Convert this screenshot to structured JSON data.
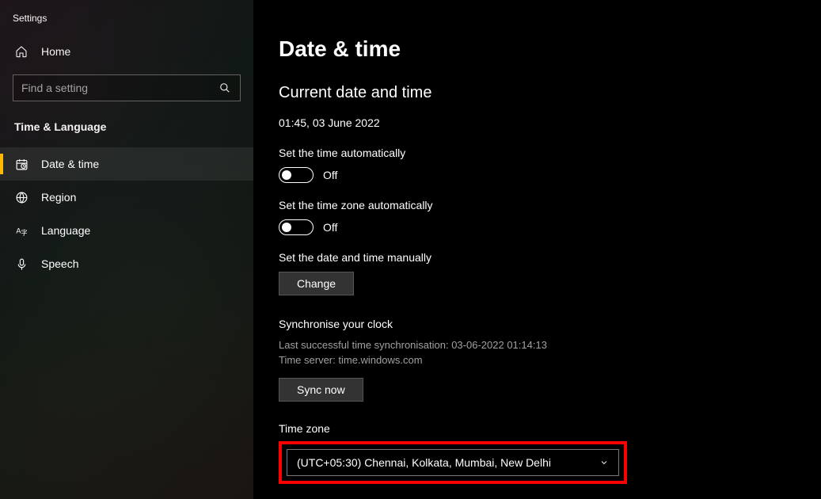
{
  "app": {
    "title": "Settings"
  },
  "sidebar": {
    "home_label": "Home",
    "search_placeholder": "Find a setting",
    "category": "Time & Language",
    "items": [
      {
        "label": "Date & time",
        "icon": "clock-icon",
        "active": true
      },
      {
        "label": "Region",
        "icon": "globe-icon",
        "active": false
      },
      {
        "label": "Language",
        "icon": "language-icon",
        "active": false
      },
      {
        "label": "Speech",
        "icon": "microphone-icon",
        "active": false
      }
    ]
  },
  "page": {
    "title": "Date & time",
    "current_section": "Current date and time",
    "current_value": "01:45, 03 June 2022",
    "auto_time_label": "Set the time automatically",
    "auto_time_state": "Off",
    "auto_tz_label": "Set the time zone automatically",
    "auto_tz_state": "Off",
    "manual_label": "Set the date and time manually",
    "change_button": "Change",
    "sync": {
      "title": "Synchronise your clock",
      "last": "Last successful time synchronisation: 03-06-2022 01:14:13",
      "server": "Time server: time.windows.com",
      "button": "Sync now"
    },
    "timezone": {
      "label": "Time zone",
      "value": "(UTC+05:30) Chennai, Kolkata, Mumbai, New Delhi"
    }
  }
}
